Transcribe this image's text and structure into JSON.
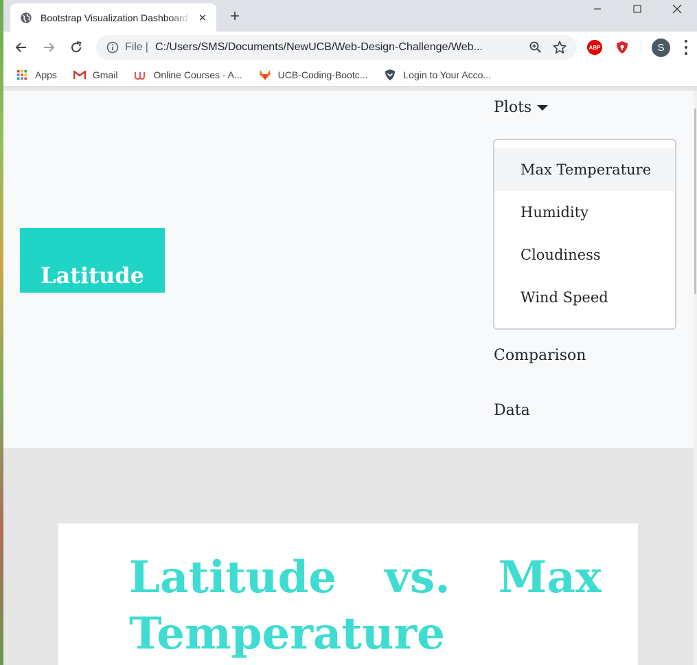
{
  "browser": {
    "tab_title": "Bootstrap Visualization Dashboard",
    "new_tab_symbol": "+",
    "close_symbol": "✕",
    "address_scheme": "File",
    "address_separator": "|",
    "address_url": "C:/Users/SMS/Documents/NewUCB/Web-Design-Challenge/Web...",
    "abp_label": "ABP",
    "profile_initial": "S"
  },
  "bookmarks": [
    {
      "label": "Apps",
      "icon": "apps-grid-icon"
    },
    {
      "label": "Gmail",
      "icon": "gmail-icon"
    },
    {
      "label": "Online Courses - A...",
      "icon": "udemy-icon"
    },
    {
      "label": "UCB-Coding-Bootc...",
      "icon": "gitlab-icon"
    },
    {
      "label": "Login to Your Acco...",
      "icon": "shield-check-icon"
    }
  ],
  "navbar": {
    "brand": "Latitude",
    "plots_label": "Plots",
    "dropdown_items": [
      "Max Temperature",
      "Humidity",
      "Cloudiness",
      "Wind Speed"
    ],
    "comparison_label": "Comparison",
    "data_label": "Data"
  },
  "main": {
    "title": "Latitude vs. Max Temperature"
  },
  "colors": {
    "brand_bg": "#20d4c6",
    "title_color": "#3fdcd1",
    "navbar_bg": "#f8f9fa",
    "page_bg": "#e6e6e6"
  }
}
